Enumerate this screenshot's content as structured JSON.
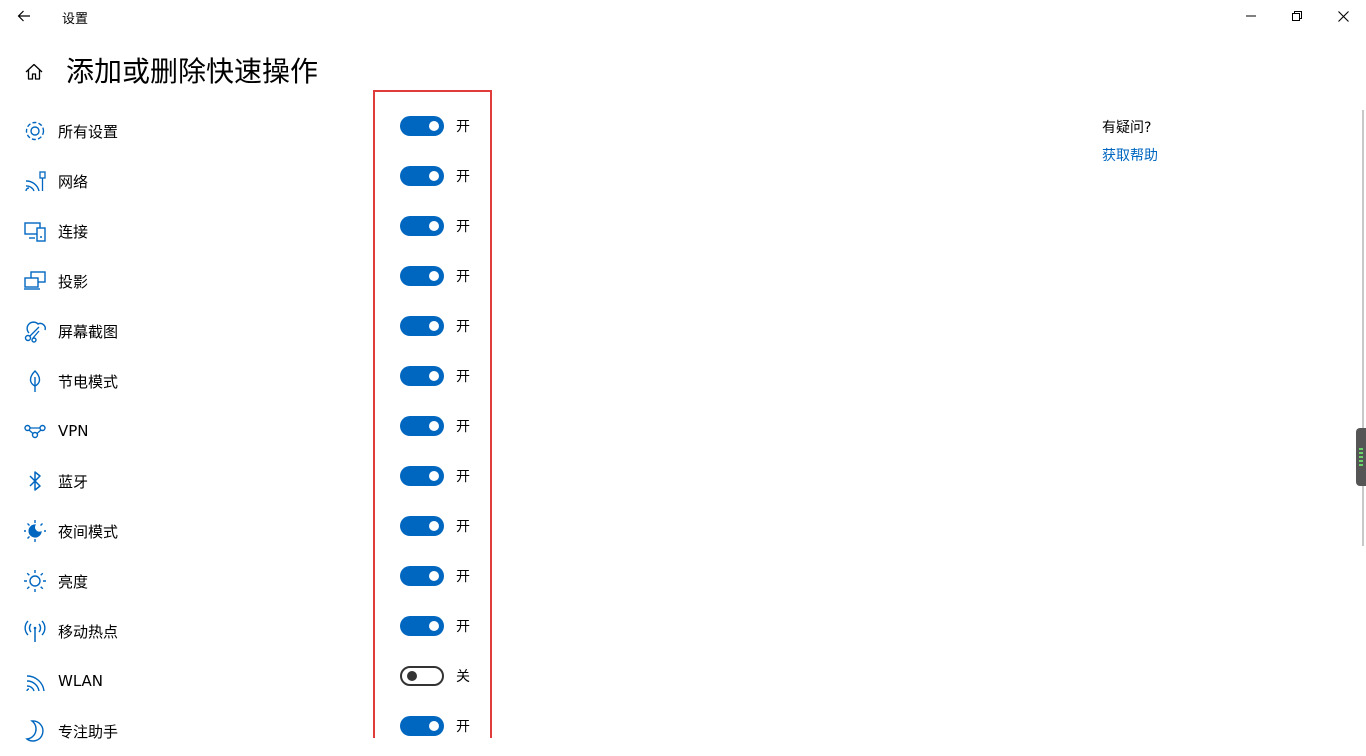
{
  "window": {
    "title": "设置"
  },
  "page": {
    "title": "添加或删除快速操作"
  },
  "actions": [
    {
      "label": "所有设置",
      "icon": "gear-icon",
      "state": "开",
      "on": true
    },
    {
      "label": "网络",
      "icon": "network-icon",
      "state": "开",
      "on": true
    },
    {
      "label": "连接",
      "icon": "connect-icon",
      "state": "开",
      "on": true
    },
    {
      "label": "投影",
      "icon": "project-icon",
      "state": "开",
      "on": true
    },
    {
      "label": "屏幕截图",
      "icon": "snip-icon",
      "state": "开",
      "on": true
    },
    {
      "label": "节电模式",
      "icon": "battery-saver-icon",
      "state": "开",
      "on": true
    },
    {
      "label": "VPN",
      "icon": "vpn-icon",
      "state": "开",
      "on": true
    },
    {
      "label": "蓝牙",
      "icon": "bluetooth-icon",
      "state": "开",
      "on": true
    },
    {
      "label": "夜间模式",
      "icon": "night-light-icon",
      "state": "开",
      "on": true
    },
    {
      "label": "亮度",
      "icon": "brightness-icon",
      "state": "开",
      "on": true
    },
    {
      "label": "移动热点",
      "icon": "hotspot-icon",
      "state": "开",
      "on": true
    },
    {
      "label": "WLAN",
      "icon": "wifi-icon",
      "state": "关",
      "on": false
    },
    {
      "label": "专注助手",
      "icon": "focus-assist-icon",
      "state": "开",
      "on": true
    }
  ],
  "help": {
    "title": "有疑问?",
    "link": "获取帮助"
  },
  "colors": {
    "accent": "#0067c0",
    "highlight_border": "#e03c3c"
  }
}
